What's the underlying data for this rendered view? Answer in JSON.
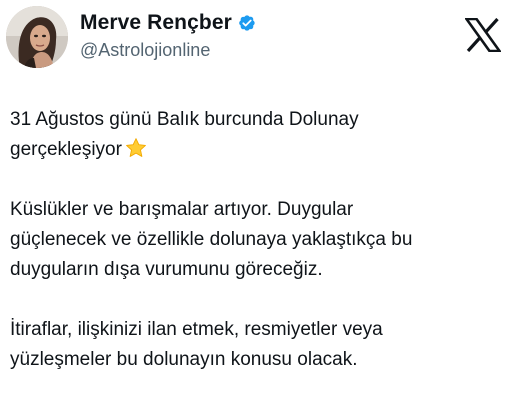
{
  "author": {
    "display_name": "Merve Rençber",
    "handle": "@Astrolojionline",
    "verified": true,
    "avatar_icon": "profile-photo",
    "badge_color": "#1d9bf0"
  },
  "platform": {
    "logo_icon": "x-logo-icon"
  },
  "tweet": {
    "paragraphs": [
      {
        "lines": [
          "31 Ağustos günü Balık burcunda Dolunay",
          "gerçekleşiyor"
        ],
        "trailing_emoji": "star-icon"
      },
      {
        "lines": [
          "Küslükler ve barışmalar artıyor. Duygular",
          "güçlenecek ve özellikle dolunaya yaklaştıkça bu",
          "duyguların dışa vurumunu göreceğiz."
        ]
      },
      {
        "lines": [
          "İtiraflar, ilişkinizi ilan etmek, resmiyetler veya",
          "yüzleşmeler bu dolunayın konusu olacak."
        ]
      }
    ]
  },
  "colors": {
    "text": "#0f1419",
    "secondary_text": "#536471",
    "background": "#ffffff",
    "star": "#ffcc33"
  }
}
